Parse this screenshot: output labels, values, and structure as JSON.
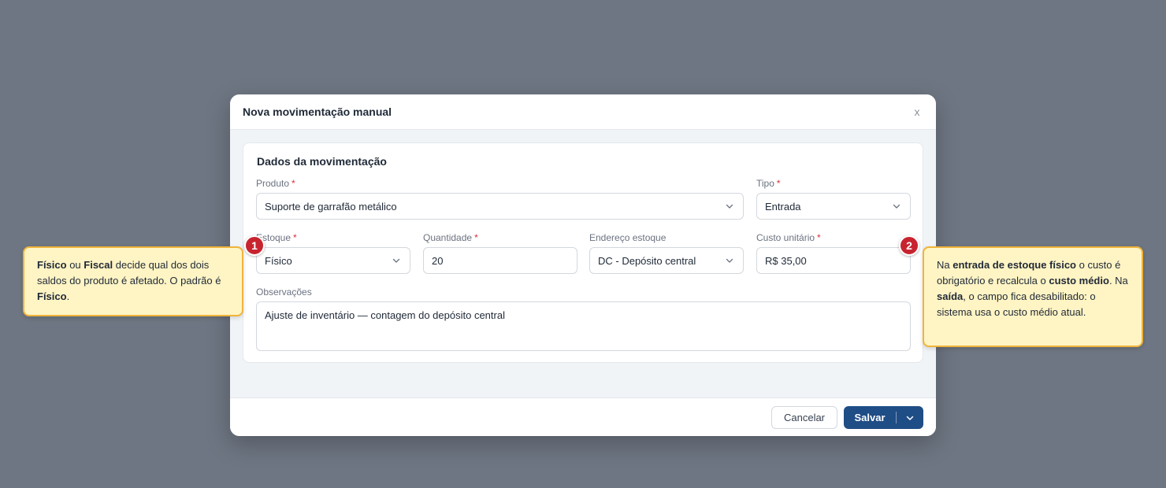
{
  "modal": {
    "title": "Nova movimentação manual",
    "close_label": "x"
  },
  "section": {
    "title": "Dados da movimentação"
  },
  "fields": {
    "produto": {
      "label": "Produto",
      "required": "*",
      "value": "Suporte de garrafão metálico"
    },
    "tipo": {
      "label": "Tipo",
      "required": "*",
      "value": "Entrada"
    },
    "estoque": {
      "label": "Estoque",
      "required": "*",
      "value": "Físico"
    },
    "quantidade": {
      "label": "Quantidade",
      "required": "*",
      "value": "20"
    },
    "endereco": {
      "label": "Endereço estoque",
      "value": "DC - Depósito central"
    },
    "custo": {
      "label": "Custo unitário",
      "required": "*",
      "value": "R$ 35,00"
    },
    "observacoes": {
      "label": "Observações",
      "value": "Ajuste de inventário — contagem do depósito central"
    }
  },
  "footer": {
    "cancel_label": "Cancelar",
    "save_label": "Salvar"
  },
  "callouts": {
    "one": {
      "number": "1",
      "parts": [
        "Físico",
        " ou ",
        "Fiscal",
        " decide qual dos dois saldos do produto é afetado. O padrão é ",
        "Físico",
        "."
      ]
    },
    "two": {
      "number": "2",
      "parts": [
        "Na ",
        "entrada de estoque físico",
        " o custo é obrigatório e recalcula o ",
        "custo médio",
        ". Na ",
        "saída",
        ", o campo fica desabilitado: o sistema usa o custo médio atual."
      ]
    }
  },
  "icons": {
    "chevron": "chevron-down-icon"
  },
  "colors": {
    "backdrop": "#6e7683",
    "primary": "#1f4d86",
    "required": "#d92d3a",
    "callout_bg": "#fff4c4",
    "callout_border": "#f0b43a",
    "badge": "#c8242f"
  }
}
